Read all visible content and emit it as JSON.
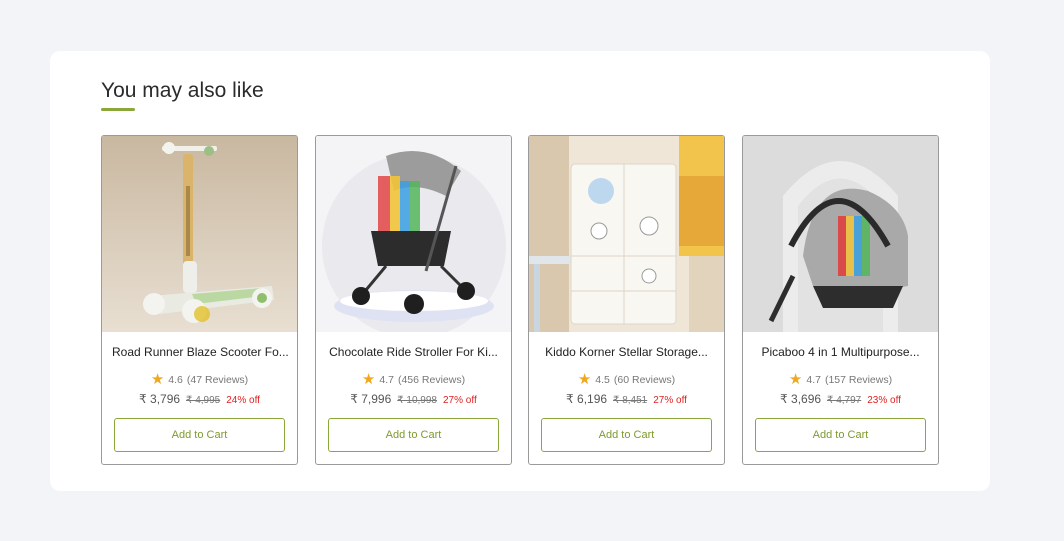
{
  "section": {
    "title": "You may also like",
    "accent_color": "#8aa83a"
  },
  "products": [
    {
      "title": "Road Runner Blaze Scooter Fo...",
      "rating": "4.6",
      "reviews": "(47 Reviews)",
      "price": "₹ 3,796",
      "mrp": "₹ 4,995",
      "discount": "24% off",
      "button": "Add to Cart",
      "image_icon": "kick-scooter-image"
    },
    {
      "title": "Chocolate Ride Stroller For Ki...",
      "rating": "4.7",
      "reviews": "(456 Reviews)",
      "price": "₹ 7,996",
      "mrp": "₹ 10,998",
      "discount": "27% off",
      "button": "Add to Cart",
      "image_icon": "baby-stroller-image"
    },
    {
      "title": "Kiddo Korner Stellar Storage...",
      "rating": "4.5",
      "reviews": "(60 Reviews)",
      "price": "₹ 6,196",
      "mrp": "₹ 8,451",
      "discount": "27% off",
      "button": "Add to Cart",
      "image_icon": "storage-cabinet-image"
    },
    {
      "title": "Picaboo 4 in 1 Multipurpose...",
      "rating": "4.7",
      "reviews": "(157 Reviews)",
      "price": "₹ 3,696",
      "mrp": "₹ 4,797",
      "discount": "23% off",
      "button": "Add to Cart",
      "image_icon": "baby-car-seat-image"
    }
  ]
}
